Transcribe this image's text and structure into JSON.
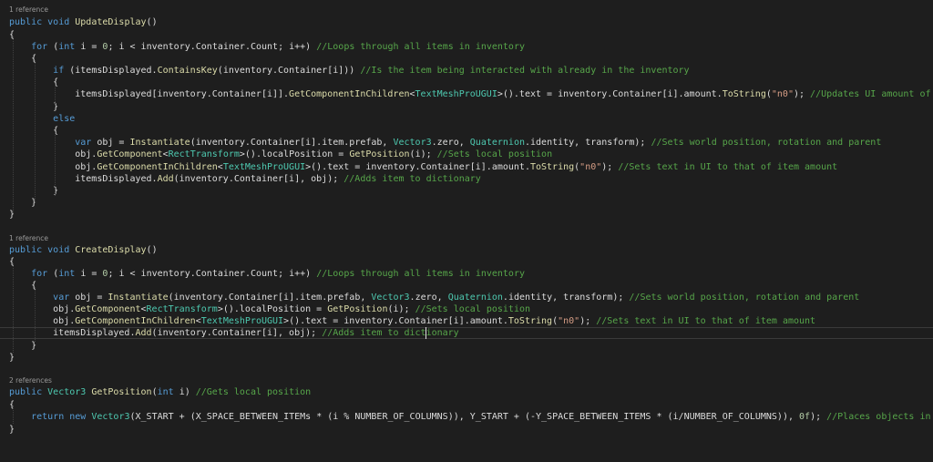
{
  "editor": {
    "lines": [
      {
        "type": "lens",
        "text": "1 reference"
      },
      {
        "type": "code",
        "tokens": [
          [
            "kw",
            "public "
          ],
          [
            "kw",
            "void "
          ],
          [
            "fn",
            "UpdateDisplay"
          ],
          [
            "pl",
            "()"
          ]
        ]
      },
      {
        "type": "code",
        "tokens": [
          [
            "pl",
            "{"
          ]
        ]
      },
      {
        "type": "code",
        "tokens": [
          [
            "pl",
            "    "
          ],
          [
            "kw",
            "for "
          ],
          [
            "pl",
            "("
          ],
          [
            "kw",
            "int "
          ],
          [
            "pl",
            "i = "
          ],
          [
            "num",
            "0"
          ],
          [
            "pl",
            "; i < inventory.Container.Count; i++) "
          ],
          [
            "cm",
            "//Loops through all items in inventory"
          ]
        ]
      },
      {
        "type": "code",
        "tokens": [
          [
            "pl",
            "    {"
          ]
        ]
      },
      {
        "type": "code",
        "tokens": [
          [
            "pl",
            "        "
          ],
          [
            "kw",
            "if "
          ],
          [
            "pl",
            "(itemsDisplayed."
          ],
          [
            "fn",
            "ContainsKey"
          ],
          [
            "pl",
            "(inventory.Container[i])) "
          ],
          [
            "cm",
            "//Is the item being interacted with already in the inventory"
          ]
        ]
      },
      {
        "type": "code",
        "tokens": [
          [
            "pl",
            "        {"
          ]
        ]
      },
      {
        "type": "code",
        "tokens": [
          [
            "pl",
            "            itemsDisplayed[inventory.Container[i]]."
          ],
          [
            "fn",
            "GetComponentInChildren"
          ],
          [
            "pl",
            "<"
          ],
          [
            "ty",
            "TextMeshProUGUI"
          ],
          [
            "pl",
            ">().text = inventory.Container[i].amount."
          ],
          [
            "fn",
            "ToString"
          ],
          [
            "pl",
            "("
          ],
          [
            "str",
            "\"n0\""
          ],
          [
            "pl",
            "); "
          ],
          [
            "cm",
            "//Updates UI amount of item in inventory"
          ]
        ]
      },
      {
        "type": "code",
        "tokens": [
          [
            "pl",
            "        }"
          ]
        ]
      },
      {
        "type": "code",
        "tokens": [
          [
            "pl",
            "        "
          ],
          [
            "kw",
            "else"
          ]
        ]
      },
      {
        "type": "code",
        "tokens": [
          [
            "pl",
            "        {"
          ]
        ]
      },
      {
        "type": "code",
        "tokens": [
          [
            "pl",
            "            "
          ],
          [
            "kw",
            "var "
          ],
          [
            "pl",
            "obj = "
          ],
          [
            "fn",
            "Instantiate"
          ],
          [
            "pl",
            "(inventory.Container[i].item.prefab, "
          ],
          [
            "ty",
            "Vector3"
          ],
          [
            "pl",
            ".zero, "
          ],
          [
            "ty",
            "Quaternion"
          ],
          [
            "pl",
            ".identity, transform); "
          ],
          [
            "cm",
            "//Sets world position, rotation and parent"
          ]
        ]
      },
      {
        "type": "code",
        "tokens": [
          [
            "pl",
            "            obj."
          ],
          [
            "fn",
            "GetComponent"
          ],
          [
            "pl",
            "<"
          ],
          [
            "ty",
            "RectTransform"
          ],
          [
            "pl",
            ">().localPosition = "
          ],
          [
            "fn",
            "GetPosition"
          ],
          [
            "pl",
            "(i); "
          ],
          [
            "cm",
            "//Sets local position"
          ]
        ]
      },
      {
        "type": "code",
        "tokens": [
          [
            "pl",
            "            obj."
          ],
          [
            "fn",
            "GetComponentInChildren"
          ],
          [
            "pl",
            "<"
          ],
          [
            "ty",
            "TextMeshProUGUI"
          ],
          [
            "pl",
            ">().text = inventory.Container[i].amount."
          ],
          [
            "fn",
            "ToString"
          ],
          [
            "pl",
            "("
          ],
          [
            "str",
            "\"n0\""
          ],
          [
            "pl",
            "); "
          ],
          [
            "cm",
            "//Sets text in UI to that of item amount"
          ]
        ]
      },
      {
        "type": "code",
        "tokens": [
          [
            "pl",
            "            itemsDisplayed."
          ],
          [
            "fn",
            "Add"
          ],
          [
            "pl",
            "(inventory.Container[i], obj); "
          ],
          [
            "cm",
            "//Adds item to dictionary"
          ]
        ]
      },
      {
        "type": "code",
        "tokens": [
          [
            "pl",
            "        }"
          ]
        ]
      },
      {
        "type": "code",
        "tokens": [
          [
            "pl",
            "    }"
          ]
        ]
      },
      {
        "type": "code",
        "tokens": [
          [
            "pl",
            "}"
          ]
        ]
      },
      {
        "type": "blank"
      },
      {
        "type": "lens",
        "text": "1 reference"
      },
      {
        "type": "code",
        "tokens": [
          [
            "kw",
            "public "
          ],
          [
            "kw",
            "void "
          ],
          [
            "fn",
            "CreateDisplay"
          ],
          [
            "pl",
            "()"
          ]
        ]
      },
      {
        "type": "code",
        "tokens": [
          [
            "pl",
            "{"
          ]
        ]
      },
      {
        "type": "code",
        "tokens": [
          [
            "pl",
            "    "
          ],
          [
            "kw",
            "for "
          ],
          [
            "pl",
            "("
          ],
          [
            "kw",
            "int "
          ],
          [
            "pl",
            "i = "
          ],
          [
            "num",
            "0"
          ],
          [
            "pl",
            "; i < inventory.Container.Count; i++) "
          ],
          [
            "cm",
            "//Loops through all items in inventory"
          ]
        ]
      },
      {
        "type": "code",
        "tokens": [
          [
            "pl",
            "    {"
          ]
        ]
      },
      {
        "type": "code",
        "tokens": [
          [
            "pl",
            "        "
          ],
          [
            "kw",
            "var "
          ],
          [
            "pl",
            "obj = "
          ],
          [
            "fn",
            "Instantiate"
          ],
          [
            "pl",
            "(inventory.Container[i].item.prefab, "
          ],
          [
            "ty",
            "Vector3"
          ],
          [
            "pl",
            ".zero, "
          ],
          [
            "ty",
            "Quaternion"
          ],
          [
            "pl",
            ".identity, transform); "
          ],
          [
            "cm",
            "//Sets world position, rotation and parent"
          ]
        ]
      },
      {
        "type": "code",
        "tokens": [
          [
            "pl",
            "        obj."
          ],
          [
            "fn",
            "GetComponent"
          ],
          [
            "pl",
            "<"
          ],
          [
            "ty",
            "RectTransform"
          ],
          [
            "pl",
            ">().localPosition = "
          ],
          [
            "fn",
            "GetPosition"
          ],
          [
            "pl",
            "(i); "
          ],
          [
            "cm",
            "//Sets local position"
          ]
        ]
      },
      {
        "type": "code",
        "tokens": [
          [
            "pl",
            "        obj."
          ],
          [
            "fn",
            "GetComponentInChildren"
          ],
          [
            "pl",
            "<"
          ],
          [
            "ty",
            "TextMeshProUGUI"
          ],
          [
            "pl",
            ">().text = inventory.Container[i].amount."
          ],
          [
            "fn",
            "ToString"
          ],
          [
            "pl",
            "("
          ],
          [
            "str",
            "\"n0\""
          ],
          [
            "pl",
            "); "
          ],
          [
            "cm",
            "//Sets text in UI to that of item amount"
          ]
        ]
      },
      {
        "type": "code",
        "tokens": [
          [
            "pl",
            "        itemsDisplayed."
          ],
          [
            "fn",
            "Add"
          ],
          [
            "pl",
            "(inventory.Container[i], obj); "
          ],
          [
            "cm",
            "//Adds item to dictionary"
          ]
        ]
      },
      {
        "type": "code",
        "tokens": [
          [
            "pl",
            "    }"
          ]
        ]
      },
      {
        "type": "code",
        "tokens": [
          [
            "pl",
            "}"
          ]
        ]
      },
      {
        "type": "blank"
      },
      {
        "type": "blank"
      },
      {
        "type": "lens",
        "text": "2 references"
      },
      {
        "type": "code",
        "tokens": [
          [
            "kw",
            "public "
          ],
          [
            "ty",
            "Vector3 "
          ],
          [
            "fn",
            "GetPosition"
          ],
          [
            "pl",
            "("
          ],
          [
            "kw",
            "int "
          ],
          [
            "pl",
            "i) "
          ],
          [
            "cm",
            "//Gets local position"
          ]
        ]
      },
      {
        "type": "code",
        "tokens": [
          [
            "pl",
            "{"
          ]
        ]
      },
      {
        "type": "code",
        "tokens": [
          [
            "pl",
            "    "
          ],
          [
            "kw",
            "return "
          ],
          [
            "kw",
            "new "
          ],
          [
            "ty",
            "Vector3"
          ],
          [
            "pl",
            "(X_START + (X_SPACE_BETWEEN_ITEMs * (i % NUMBER_OF_COLUMNS)), Y_START + (-Y_SPACE_BETWEEN_ITEMS * (i/NUMBER_OF_COLUMNS)), "
          ],
          [
            "num",
            "0f"
          ],
          [
            "pl",
            "); "
          ],
          [
            "cm",
            "//Places objects in a grid"
          ]
        ]
      },
      {
        "type": "code",
        "tokens": [
          [
            "pl",
            "}"
          ]
        ]
      }
    ]
  }
}
